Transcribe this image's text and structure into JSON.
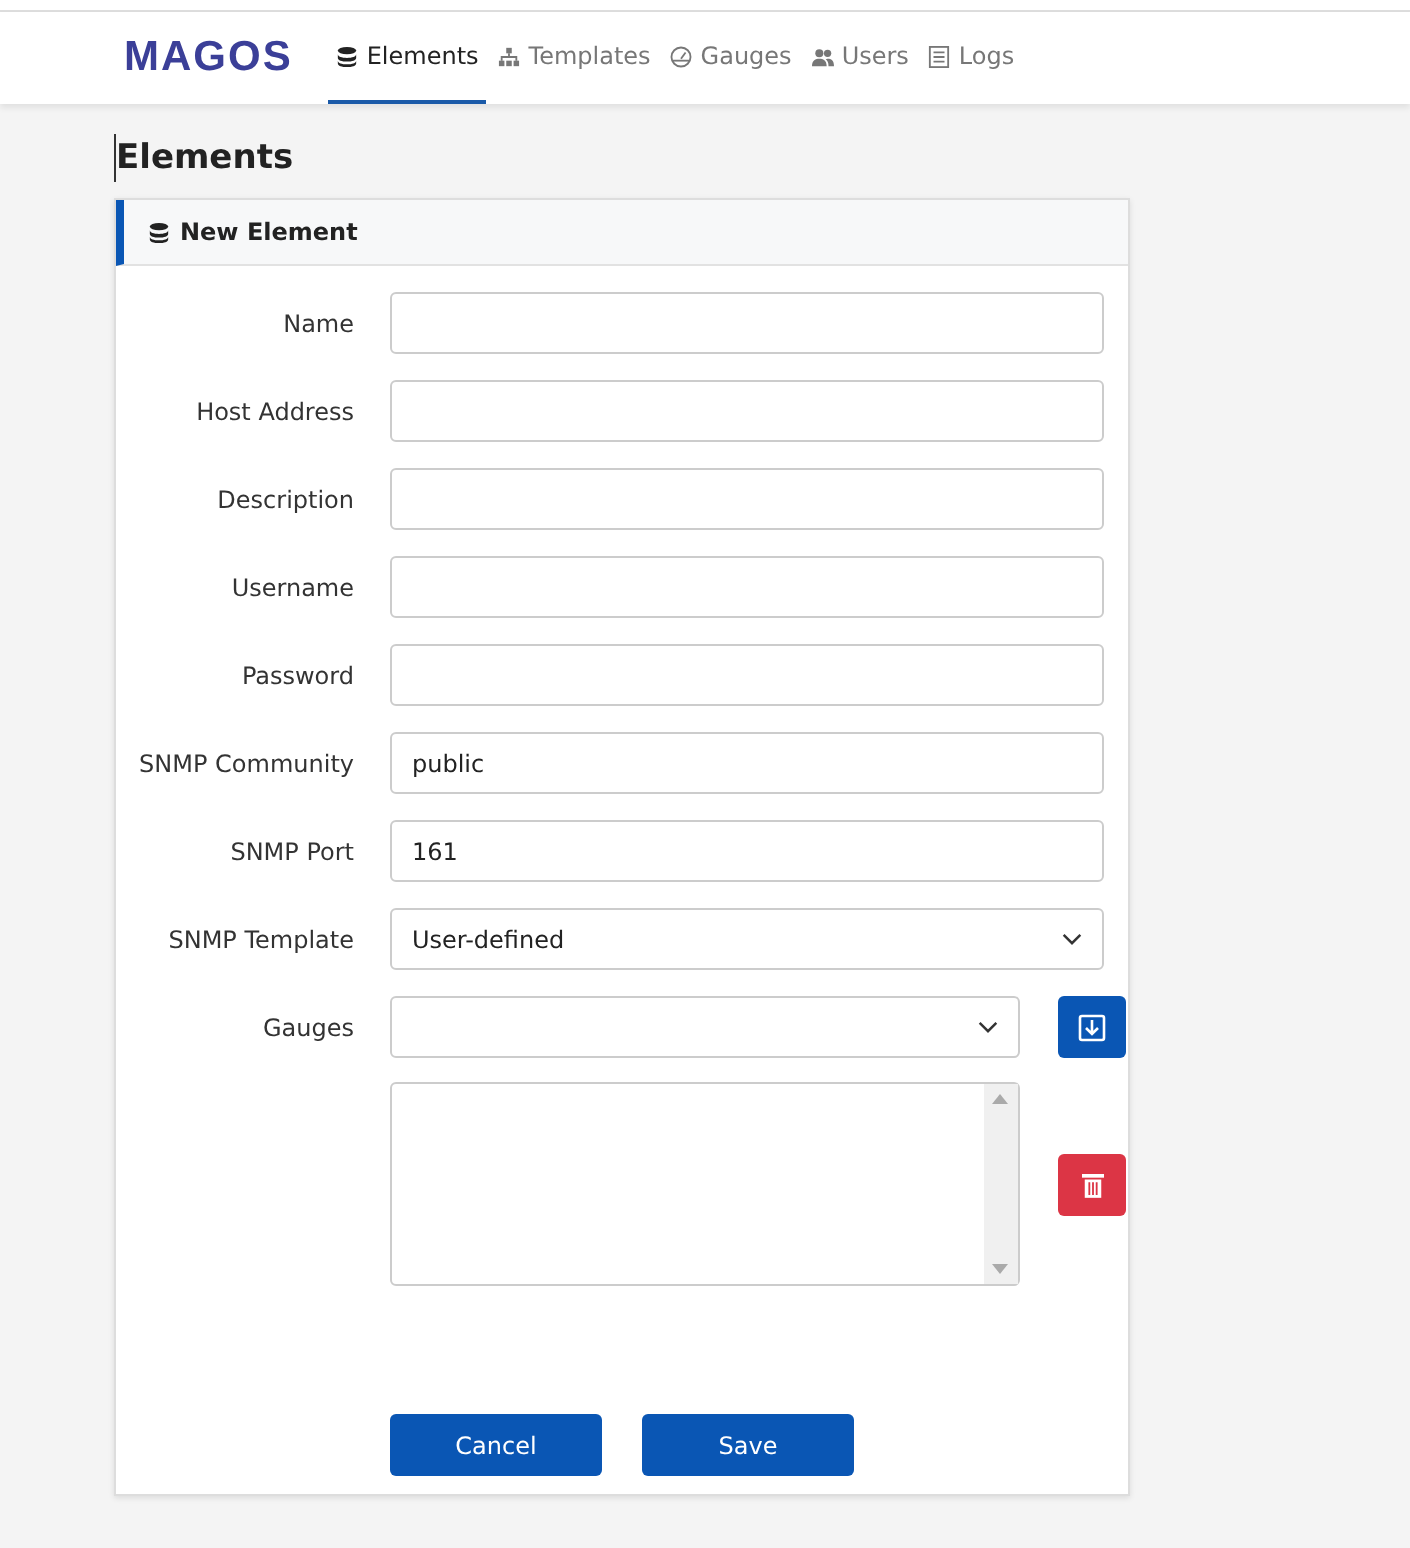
{
  "logo": "MAGOS",
  "nav": [
    {
      "label": "Elements",
      "kind": "database",
      "selected": true
    },
    {
      "label": "Templates",
      "kind": "sitemap",
      "selected": false
    },
    {
      "label": "Gauges",
      "kind": "gauge",
      "selected": false
    },
    {
      "label": "Users",
      "kind": "users",
      "selected": false
    },
    {
      "label": "Logs",
      "kind": "list",
      "selected": false
    }
  ],
  "heading": "Elements",
  "card": {
    "title": "New Element",
    "fields": [
      {
        "label": "Name",
        "kind": "input"
      },
      {
        "label": "Host Address",
        "kind": "input"
      },
      {
        "label": "Description",
        "kind": "input"
      },
      {
        "label": "Username",
        "kind": "input"
      },
      {
        "label": "Password",
        "kind": "input"
      },
      {
        "label": "SNMP Community",
        "kind": "input",
        "value": "public"
      },
      {
        "label": "SNMP Port",
        "kind": "input",
        "value": "161"
      },
      {
        "label": "SNMP Template",
        "kind": "select",
        "value": "User-defined"
      }
    ],
    "gauges": {
      "label": "Gauges"
    },
    "buttons": [
      "Cancel",
      "Save"
    ]
  }
}
